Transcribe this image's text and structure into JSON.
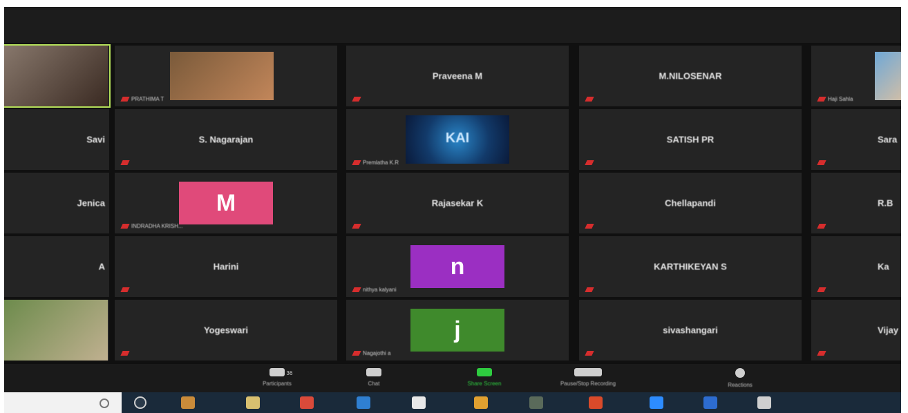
{
  "participants": [
    {
      "name": "",
      "kind": "video",
      "muted": false,
      "label": "",
      "colors": [
        "#8a7a6e",
        "#3a2a22"
      ]
    },
    {
      "name": "",
      "kind": "video",
      "muted": true,
      "label": "PRATHIMA T",
      "colors": [
        "#7a5a3a",
        "#c2865a"
      ]
    },
    {
      "name": "Praveena M",
      "kind": "name",
      "muted": true,
      "label": ""
    },
    {
      "name": "M.NILOSENAR",
      "kind": "name",
      "muted": true,
      "label": ""
    },
    {
      "name": "",
      "kind": "video",
      "muted": true,
      "label": "Haji Sahla",
      "colors": [
        "#6fa8d6",
        "#d8c0a4"
      ]
    },
    {
      "name": "Savi",
      "kind": "name",
      "muted": false,
      "label": ""
    },
    {
      "name": "S. Nagarajan",
      "kind": "name",
      "muted": true,
      "label": ""
    },
    {
      "name": "",
      "kind": "logo",
      "muted": true,
      "label": "Premlatha K.R",
      "logo_text": "KAI"
    },
    {
      "name": "SATISH PR",
      "kind": "name",
      "muted": true,
      "label": ""
    },
    {
      "name": "Sara",
      "kind": "name",
      "muted": true,
      "label": ""
    },
    {
      "name": "Jenica",
      "kind": "name",
      "muted": false,
      "label": ""
    },
    {
      "name": "",
      "kind": "avatar",
      "muted": true,
      "label": "INDRADHA KRISH...",
      "letter": "M",
      "color": "#e04a7a"
    },
    {
      "name": "Rajasekar K",
      "kind": "name",
      "muted": true,
      "label": ""
    },
    {
      "name": "Chellapandi",
      "kind": "name",
      "muted": true,
      "label": ""
    },
    {
      "name": "R.B",
      "kind": "name",
      "muted": true,
      "label": ""
    },
    {
      "name": "A",
      "kind": "name",
      "muted": false,
      "label": ""
    },
    {
      "name": "Harini",
      "kind": "name",
      "muted": true,
      "label": ""
    },
    {
      "name": "",
      "kind": "avatar",
      "muted": true,
      "label": "nithya kalyani",
      "letter": "n",
      "color": "#9b2fc2"
    },
    {
      "name": "KARTHIKEYAN S",
      "kind": "name",
      "muted": true,
      "label": ""
    },
    {
      "name": "Ka",
      "kind": "name",
      "muted": true,
      "label": ""
    },
    {
      "name": "",
      "kind": "video",
      "muted": false,
      "label": "",
      "colors": [
        "#6a8a4a",
        "#c0b090"
      ]
    },
    {
      "name": "Yogeswari",
      "kind": "name",
      "muted": true,
      "label": ""
    },
    {
      "name": "",
      "kind": "avatar",
      "muted": true,
      "label": "Nagajothi a",
      "letter": "j",
      "color": "#3f8a2c"
    },
    {
      "name": "sivashangari",
      "kind": "name",
      "muted": true,
      "label": ""
    },
    {
      "name": "Vijay",
      "kind": "name",
      "muted": true,
      "label": ""
    }
  ],
  "toolbar": [
    {
      "id": "participants",
      "label": "Participants",
      "count": "36",
      "color": "#cfcfcf"
    },
    {
      "id": "chat",
      "label": "Chat",
      "color": "#cfcfcf"
    },
    {
      "id": "share-screen",
      "label": "Share Screen",
      "color": "#2ecc40"
    },
    {
      "id": "record",
      "label": "Pause/Stop Recording",
      "color": "#cfcfcf"
    },
    {
      "id": "reactions",
      "label": "Reactions",
      "color": "#cfcfcf"
    }
  ],
  "taskbar": {
    "apps": [
      {
        "name": "cortana-icon",
        "color": "#2a3a4a"
      },
      {
        "name": "task-view-icon",
        "color": "#c98b3a"
      },
      {
        "name": "file-explorer-icon",
        "color": "#d8c070"
      },
      {
        "name": "chrome-icon",
        "color": "#d94a3a"
      },
      {
        "name": "edge-icon",
        "color": "#2f7fd1"
      },
      {
        "name": "notepad-icon",
        "color": "#e8e8e8"
      },
      {
        "name": "store-icon",
        "color": "#e0a030"
      },
      {
        "name": "photos-icon",
        "color": "#5a6a5a"
      },
      {
        "name": "firefox-icon",
        "color": "#d94a2a"
      },
      {
        "name": "zoom-icon",
        "color": "#2d8cff"
      },
      {
        "name": "mail-icon",
        "color": "#2d6cd0"
      },
      {
        "name": "feather-icon",
        "color": "#cfcfcf"
      }
    ]
  }
}
